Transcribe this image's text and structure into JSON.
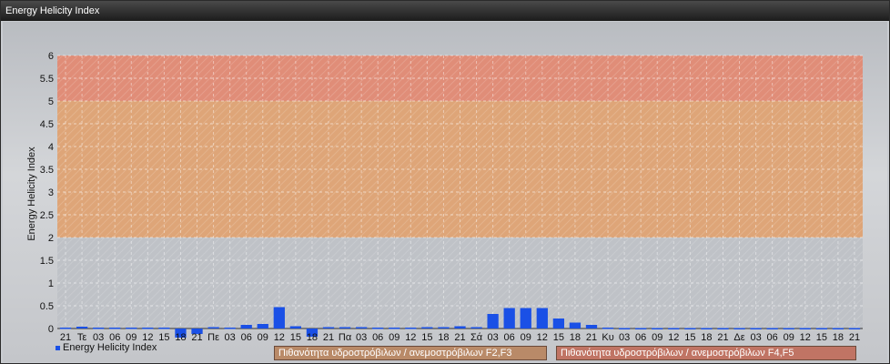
{
  "window": {
    "title": "Energy Helicity Index"
  },
  "legend": {
    "series_label": "Energy Helicity Index"
  },
  "bands": [
    {
      "label": "Πιθανότητα υδροστρόβιλων / ανεμοστρόβιλων F2,F3",
      "from": 2,
      "to": 5,
      "color": "#e3a06a"
    },
    {
      "label": "Πιθανότητα υδροστρόβιλων / ανεμοστρόβιλων F4,F5",
      "from": 5,
      "to": 6,
      "color": "#e5846a"
    }
  ],
  "chart_data": {
    "type": "bar",
    "ylabel": "Energy Helicity Index",
    "ylim": [
      0,
      6
    ],
    "yticks": [
      "0",
      "0.5",
      "1",
      "1.5",
      "2",
      "2.5",
      "3",
      "3.5",
      "4",
      "4.5",
      "5",
      "5.5",
      "6"
    ],
    "categories": [
      "21",
      "Τε",
      "03",
      "06",
      "09",
      "12",
      "15",
      "18",
      "21",
      "Πε",
      "03",
      "06",
      "09",
      "12",
      "15",
      "18",
      "21",
      "Πα",
      "03",
      "06",
      "09",
      "12",
      "15",
      "18",
      "21",
      "Σά",
      "03",
      "06",
      "09",
      "12",
      "15",
      "18",
      "21",
      "Κυ",
      "03",
      "06",
      "09",
      "12",
      "15",
      "18",
      "21",
      "Δε",
      "03",
      "06",
      "09",
      "12",
      "15",
      "18",
      "21"
    ],
    "values": [
      0.02,
      0.04,
      0.02,
      0.02,
      0.02,
      0.02,
      0.02,
      -0.2,
      -0.12,
      0.03,
      0.02,
      0.08,
      0.1,
      0.47,
      0.05,
      -0.18,
      0.03,
      0.03,
      0.03,
      0.02,
      0.02,
      0.02,
      0.03,
      0.03,
      0.05,
      0.03,
      0.32,
      0.45,
      0.45,
      0.45,
      0.22,
      0.13,
      0.08,
      0.02,
      0.01,
      0.01,
      0.01,
      0.01,
      0.01,
      0.01,
      0.01,
      0.01,
      0.01,
      0.01,
      0.01,
      0.01,
      0.01,
      0.01,
      0.01
    ],
    "bar_color": "#1a50e6",
    "grid": true,
    "legend_position": "bottom-left"
  }
}
